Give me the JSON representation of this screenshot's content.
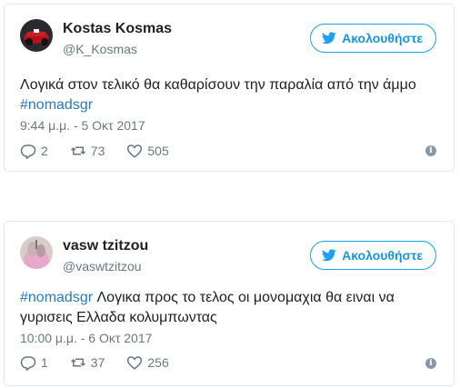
{
  "tweets": [
    {
      "name": "Kostas Kosmas",
      "handle": "@K_Kosmas",
      "follow_label": "Ακολουθήστε",
      "text_main": "Λογικά στον τελικό θα καθαρίσουν την παραλία από την άμμο",
      "hashtag": "#nomadsgr",
      "timestamp": "9:44 μ.μ. - 5 Οκτ 2017",
      "reply_count": "2",
      "retweet_count": "73",
      "like_count": "505",
      "info_glyph": "i"
    },
    {
      "name": "vasw tzitzou",
      "handle": "@vaswtzitzou",
      "follow_label": "Ακολουθήστε",
      "hashtag": "#nomadsgr",
      "text_line1": " Λογικα προς το τελος οι μονομαχια θα ειναι να",
      "text_line2": "γυρισεις Ελλαδα κολυμπωντας",
      "timestamp": "10:00 μ.μ. - 6 Οκτ 2017",
      "reply_count": "1",
      "retweet_count": "37",
      "like_count": "256",
      "info_glyph": "i"
    }
  ],
  "colors": {
    "accent": "#1da1f2",
    "link": "#2b7bb9",
    "muted": "#697882",
    "border": "#e1e8ed"
  },
  "icons": [
    "twitter-bird-icon",
    "reply-icon",
    "retweet-icon",
    "like-icon",
    "info-icon"
  ]
}
